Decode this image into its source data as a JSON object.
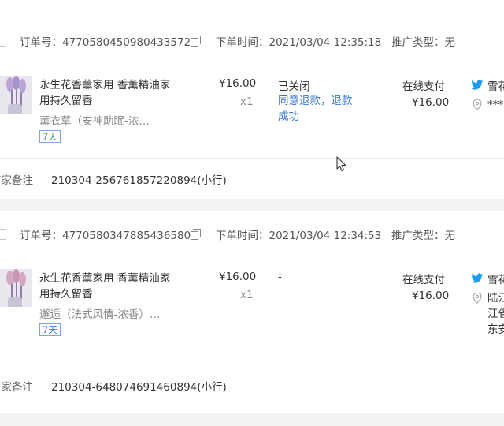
{
  "orders": [
    {
      "order_no": "订单号：4770580450980433572",
      "order_time": "下单时间：2021/03/04 12:35:18",
      "promo_type": "推广类型：无",
      "product_title": "永生花香薰家用 香薰精油家用持久留香",
      "product_sku": "薰衣草（安神助眠-浓…",
      "tag": "7天",
      "price": "¥16.00",
      "qty": "x1",
      "status": "已关闭",
      "refund_text": "同意退款，退款成功",
      "pay_type": "在线支付",
      "pay_amount": "¥16.00",
      "buyer_name": "雪花",
      "address": "***",
      "merchant_note_label": "商家备注",
      "merchant_note": "210304-256761857220894(小行)"
    },
    {
      "order_no": "订单号：4770580347885436580",
      "order_time": "下单时间：2021/03/04 12:34:53",
      "promo_type": "推广类型：无",
      "product_title": "永生花香薰家用 香薰精油家用持久留香",
      "product_sku": "邂逅（法式风情-浓香）…",
      "tag": "7天",
      "price": "¥16.00",
      "qty": "x1",
      "status": "-",
      "refund_text": "",
      "pay_type": "在线支付",
      "pay_amount": "¥16.00",
      "buyer_name": "雪花",
      "address_lines": [
        "陆江",
        "江省",
        "东安"
      ],
      "merchant_note_label": "商家备注",
      "merchant_note": "210304-648074691460894(小行)"
    }
  ],
  "icons": {
    "copy": "copy-icon",
    "buyer": "bird-icon",
    "location": "location-pin-icon",
    "cursor": "mouse-cursor-icon"
  },
  "colors": {
    "link": "#3a78d8",
    "muted": "#888888",
    "background": "#f2f3f5",
    "card": "#ffffff",
    "bird": "#1d9bf0"
  }
}
